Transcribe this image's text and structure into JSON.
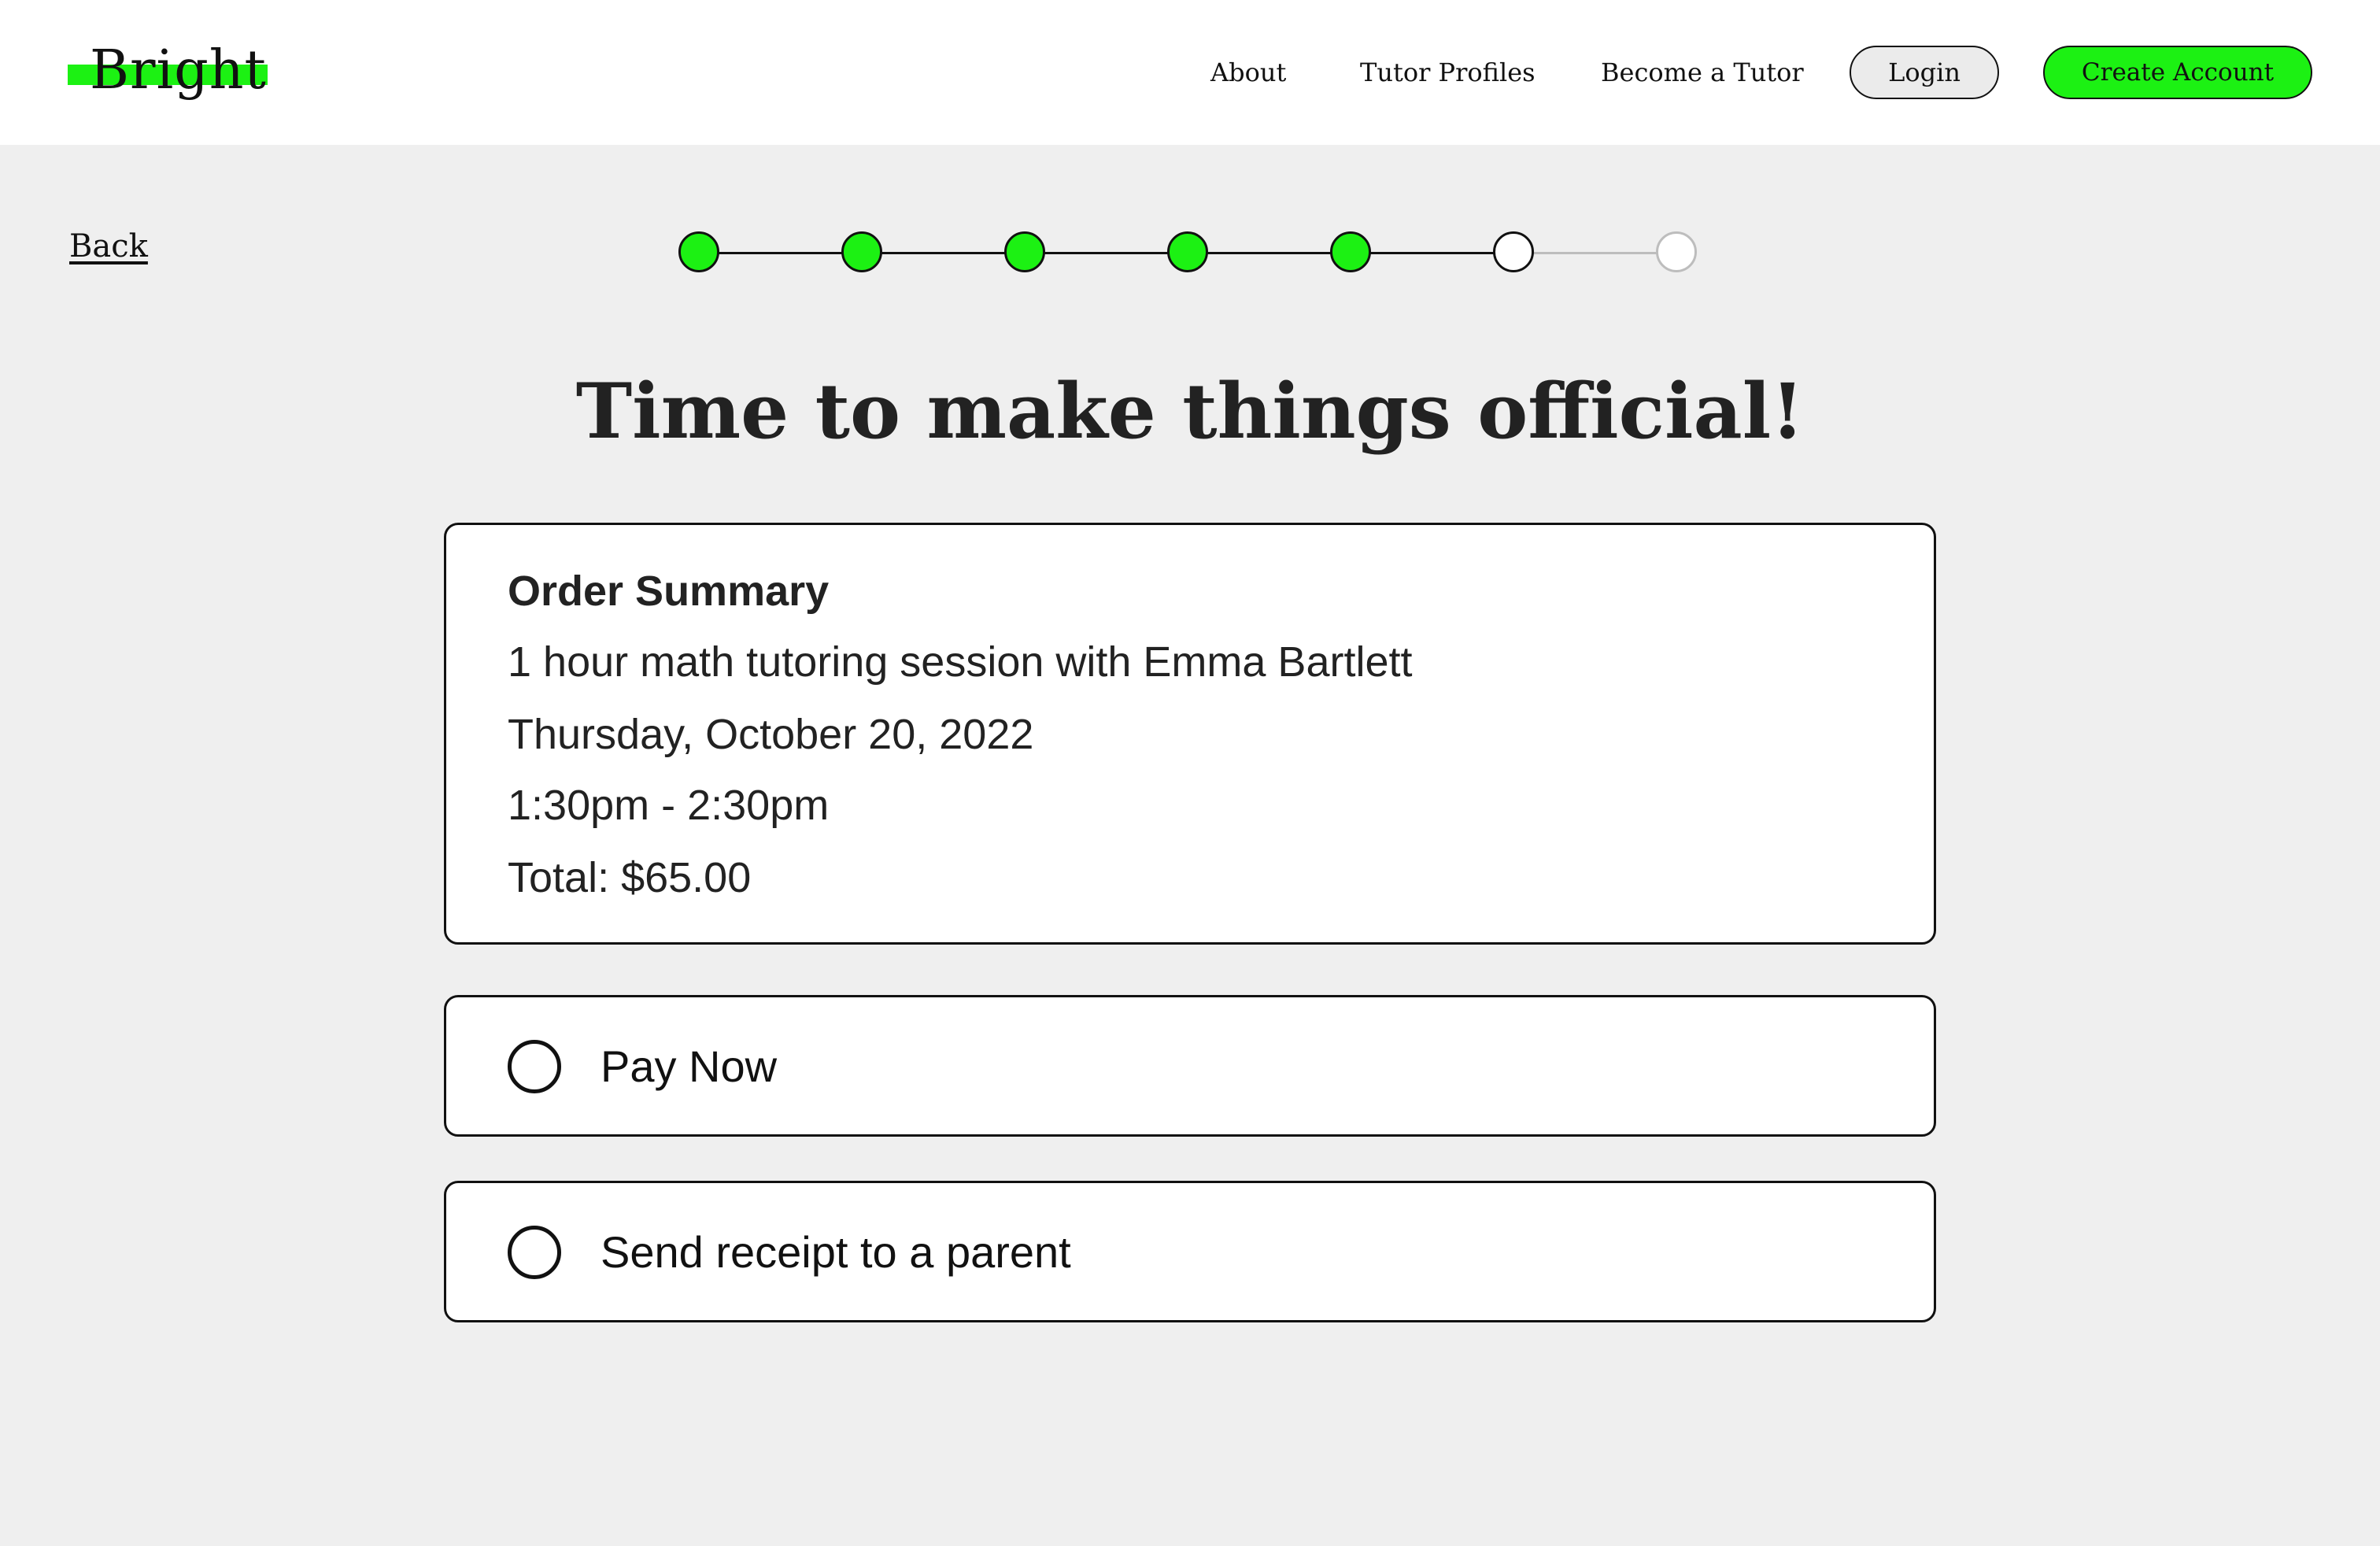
{
  "header": {
    "logo_text": "Bright",
    "nav": {
      "about": "About",
      "tutor_profiles": "Tutor Profiles",
      "become_tutor": "Become a Tutor"
    },
    "login_label": "Login",
    "create_account_label": "Create Account"
  },
  "back_label": "Back",
  "progress": {
    "total_steps": 7,
    "completed_steps": 5,
    "current_step": 6
  },
  "title": "Time to make things official!",
  "order_summary": {
    "heading": "Order Summary",
    "session": "1 hour math tutoring session with Emma Bartlett",
    "date": "Thursday, October 20, 2022",
    "time": "1:30pm - 2:30pm",
    "total": "Total: $65.00"
  },
  "options": {
    "pay_now": "Pay Now",
    "send_receipt": "Send receipt to a parent"
  },
  "colors": {
    "accent": "#1cf113",
    "background": "#efefef",
    "header_background": "#ffffff",
    "border": "#111111",
    "inactive_step": "#bdbdbd"
  }
}
